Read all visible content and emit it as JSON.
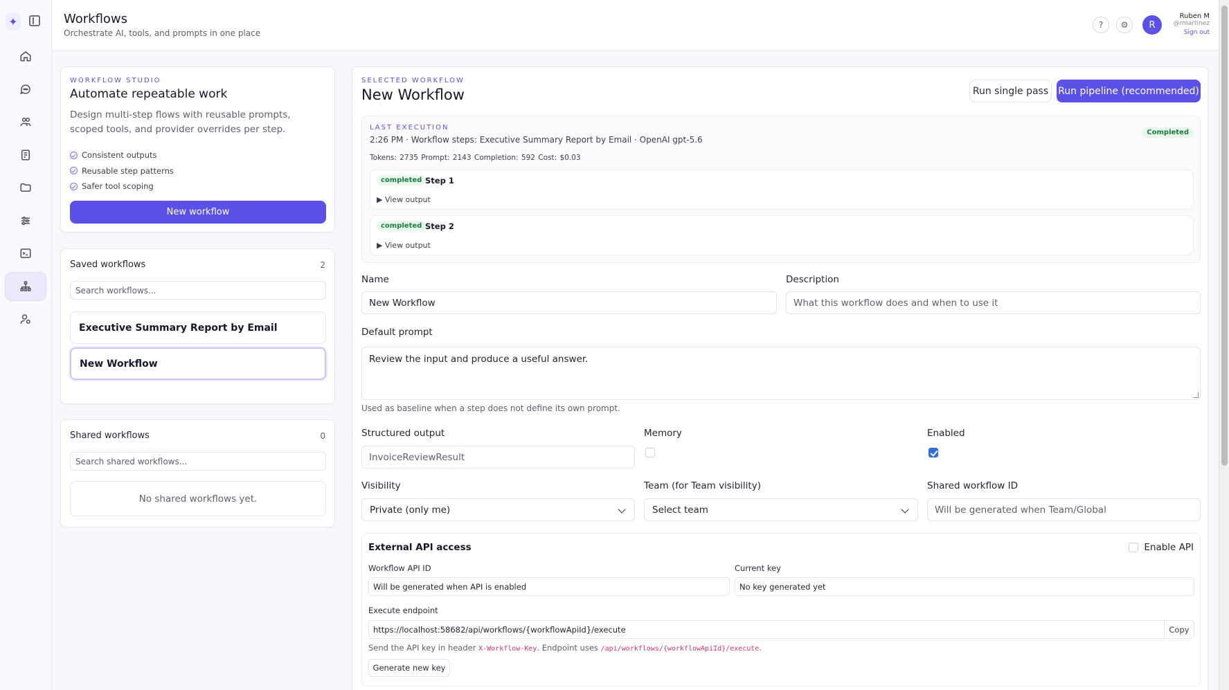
{
  "header": {
    "title": "Workflows",
    "subtitle": "Orchestrate AI, tools, and prompts in one place",
    "help_icon": "?",
    "settings_icon": "⚙"
  },
  "user": {
    "avatar_letter": "R",
    "name": "Ruben M",
    "handle": "@rmartinez",
    "sign_out": "Sign out"
  },
  "sidebar": {
    "items": [
      {
        "name": "home-icon"
      },
      {
        "name": "chat-icon"
      },
      {
        "name": "users-icon"
      },
      {
        "name": "document-icon"
      },
      {
        "name": "folder-icon"
      },
      {
        "name": "sliders-icon"
      },
      {
        "name": "terminal-icon"
      },
      {
        "name": "workflow-icon",
        "active": true
      },
      {
        "name": "user-settings-icon"
      }
    ]
  },
  "intro": {
    "eyebrow": "WORKFLOW STUDIO",
    "title": "Automate repeatable work",
    "description": "Design multi-step flows with reusable prompts, scoped tools, and provider overrides per step.",
    "bullets": [
      "Consistent outputs",
      "Reusable step patterns",
      "Safer tool scoping"
    ],
    "new_workflow_button": "New workflow"
  },
  "saved": {
    "title": "Saved workflows",
    "count": "2",
    "search_placeholder": "Search workflows...",
    "items": [
      "Executive Summary Report by Email",
      "New Workflow"
    ]
  },
  "shared": {
    "title": "Shared workflows",
    "count": "0",
    "search_placeholder": "Search shared workflows...",
    "empty": "No shared workflows yet."
  },
  "selected": {
    "eyebrow": "SELECTED WORKFLOW",
    "title": "New Workflow",
    "run_single": "Run single pass",
    "run_pipeline": "Run pipeline (recommended)"
  },
  "execution": {
    "eyebrow": "LAST EXECUTION",
    "meta": "2:26 PM · Workflow steps: Executive Summary Report by Email · OpenAI gpt-5.6",
    "status": "Completed",
    "stats": "Tokens: 2735   Prompt: 2143   Completion: 592   Cost: $0.03",
    "steps": [
      {
        "status": "completed",
        "name": "Step 1",
        "toggle": "▶ View output"
      },
      {
        "status": "completed",
        "name": "Step 2",
        "toggle": "▶ View output"
      }
    ]
  },
  "form": {
    "name_label": "Name",
    "name_value": "New Workflow",
    "description_label": "Description",
    "description_placeholder": "What this workflow does and when to use it",
    "prompt_label": "Default prompt",
    "prompt_value": "Review the input and produce a useful answer.",
    "prompt_hint": "Used as baseline when a step does not define its own prompt.",
    "structured_label": "Structured output",
    "structured_value": "InvoiceReviewResult",
    "memory_label": "Memory",
    "memory_checked": false,
    "enabled_label": "Enabled",
    "enabled_checked": true,
    "visibility_label": "Visibility",
    "visibility_value": "Private (only me)",
    "team_label": "Team (for Team visibility)",
    "team_value": "Select team",
    "shared_id_label": "Shared workflow ID",
    "shared_id_placeholder": "Will be generated when Team/Global"
  },
  "api": {
    "title": "External API access",
    "enable_label": "Enable API",
    "enabled": false,
    "workflow_id_label": "Workflow API ID",
    "workflow_id_value": "Will be generated when API is enabled",
    "current_key_label": "Current key",
    "current_key_value": "No key generated yet",
    "endpoint_label": "Execute endpoint",
    "endpoint_value": "https://localhost:58682/api/workflows/{workflowApiId}/execute",
    "copy_label": "Copy",
    "note_prefix": "Send the API key in header ",
    "note_header": "X-Workflow-Key",
    "note_middle": ". Endpoint uses ",
    "note_path": "/api/workflows/{workflowApiId}/execute",
    "note_suffix": ".",
    "generate_button": "Generate new key"
  }
}
